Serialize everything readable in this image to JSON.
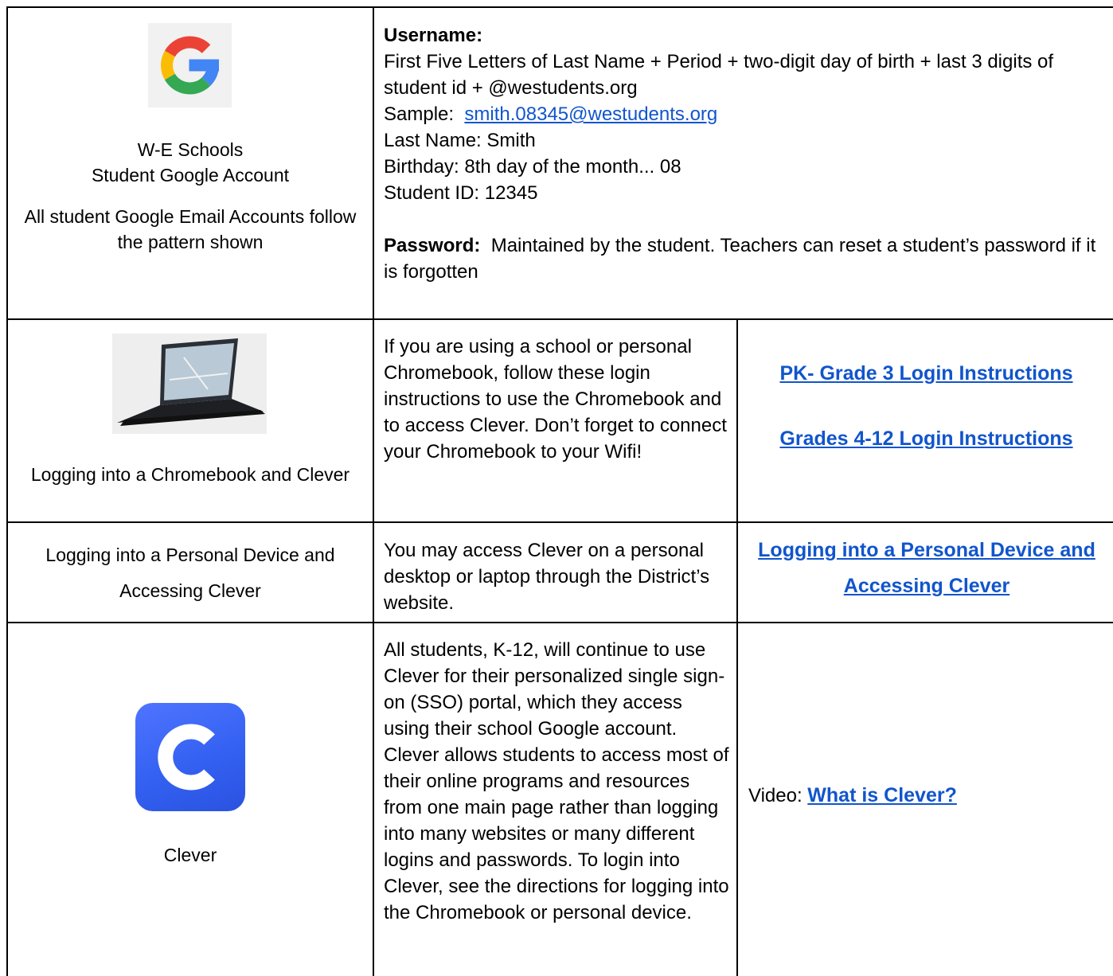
{
  "row1": {
    "account_title_line1": "W-E Schools",
    "account_title_line2": "Student Google Account",
    "pattern_note": "All student Google Email Accounts follow the pattern shown",
    "username_heading": "Username:",
    "username_rule": "First Five Letters of Last Name + Period + two-digit day of birth + last 3 digits of student id + @westudents.org",
    "sample_label": "Sample:",
    "sample_email": "smith.08345@westudents.org",
    "last_name": "Last Name: Smith",
    "birthday": "Birthday: 8th day of the month... 08",
    "student_id": "Student ID: 12345",
    "password_heading": "Password:",
    "password_text": "Maintained by the student.  Teachers can reset a student’s password if it is forgotten"
  },
  "row2": {
    "label": "Logging into a Chromebook and Clever",
    "description": "If you are using a school or personal Chromebook, follow these login instructions to use the Chromebook and to access Clever.  Don’t forget to connect your Chromebook to your Wifi!",
    "link1": "PK- Grade 3 Login Instructions",
    "link2": "Grades 4-12 Login Instructions"
  },
  "row3": {
    "label": "Logging into a Personal Device and Accessing Clever",
    "description": "You may access Clever on a personal desktop or laptop through the District’s website.",
    "link": "Logging into a Personal Device and Accessing Clever"
  },
  "row4": {
    "label": "Clever",
    "description": "All students, K-12, will continue to use Clever for their personalized single sign-on (SSO) portal, which they access using their school Google account.  Clever allows students to access most of their online programs and resources from one main page rather than logging into many websites or many different logins and passwords.   To login into Clever, see the directions for logging into the Chromebook or personal device.",
    "video_label": "Video:",
    "video_link": "What is Clever?"
  },
  "icons": {
    "google": "google-logo-icon",
    "chromebook": "chromebook-image",
    "clever": "clever-logo-icon"
  },
  "colors": {
    "link": "#1155cc",
    "google_blue": "#4285f4",
    "google_red": "#ea4335",
    "google_yellow": "#fbbc05",
    "google_green": "#34a853",
    "clever_blue": "#3461f2"
  }
}
